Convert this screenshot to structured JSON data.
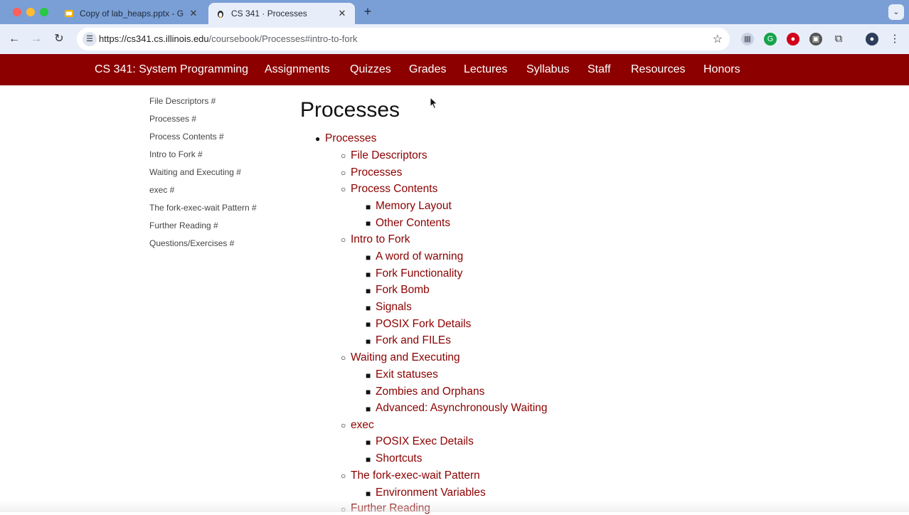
{
  "browser": {
    "tabs": [
      {
        "title": "Copy of lab_heaps.pptx - Goo",
        "icon": "slides-icon",
        "active": false
      },
      {
        "title": "CS 341 · Processes",
        "icon": "penguin-icon",
        "active": true
      }
    ],
    "url_host": "https://cs341.cs.illinois.edu",
    "url_path": "/coursebook/Processes#intro-to-fork"
  },
  "nav": {
    "brand": "CS 341: System Programming",
    "links": [
      "Assignments",
      "Quizzes",
      "Grades",
      "Lectures",
      "Syllabus",
      "Staff",
      "Resources",
      "Honors"
    ]
  },
  "sidebar": {
    "items": [
      "File Descriptors #",
      "Processes #",
      "Process Contents #",
      "Intro to Fork #",
      "Waiting and Executing #",
      "exec #",
      "The fork-exec-wait Pattern #",
      "Further Reading #",
      "Questions/Exercises #"
    ]
  },
  "page": {
    "title": "Processes",
    "toc": [
      "Processes",
      "File Descriptors",
      "Processes",
      "Process Contents",
      "Memory Layout",
      "Other Contents",
      "Intro to Fork",
      "A word of warning",
      "Fork Functionality",
      "Fork Bomb",
      "Signals",
      "POSIX Fork Details",
      "Fork and FILEs",
      "Waiting and Executing",
      "Exit statuses",
      "Zombies and Orphans",
      "Advanced: Asynchronously Waiting",
      "exec",
      "POSIX Exec Details",
      "Shortcuts",
      "The fork-exec-wait Pattern",
      "Environment Variables",
      "Further Reading"
    ]
  },
  "colors": {
    "brand": "#8c0000",
    "chrome": "#7a9fd6"
  }
}
